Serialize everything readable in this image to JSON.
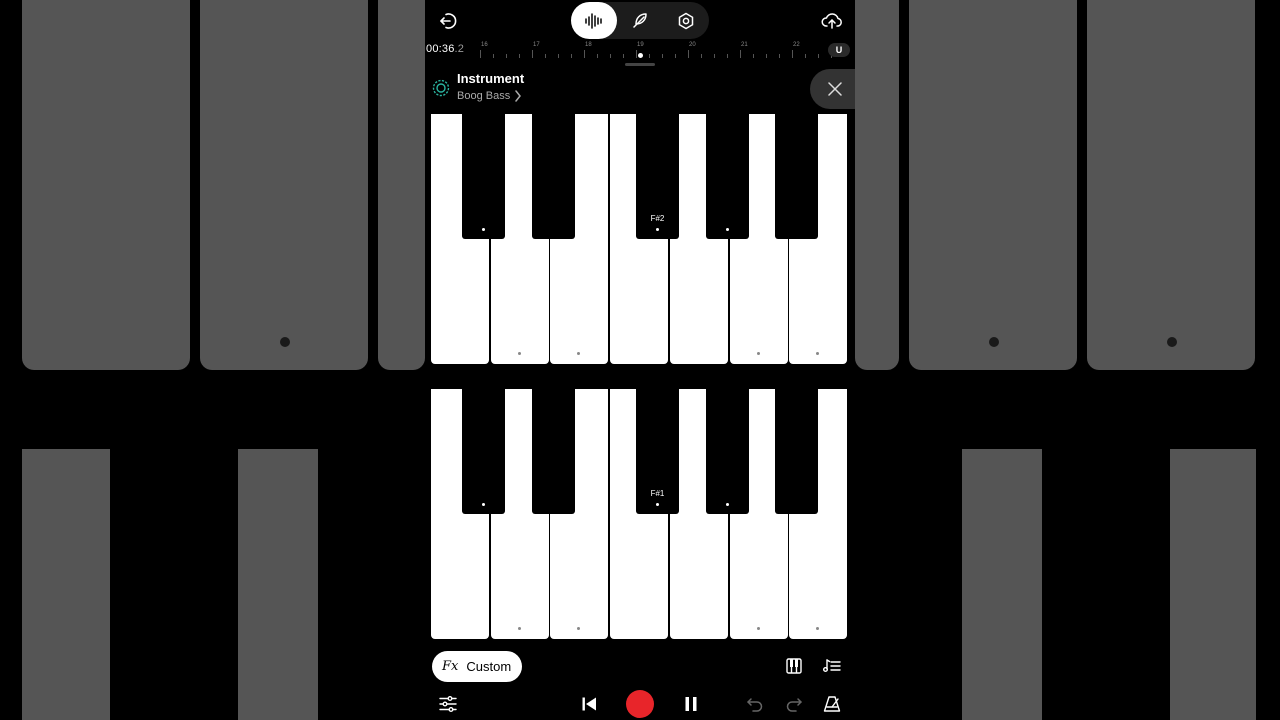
{
  "timeline": {
    "time_main": "00:36",
    "time_frac": ".2",
    "bar_labels": [
      "16",
      "17",
      "18",
      "19",
      "20",
      "21",
      "22"
    ],
    "snap_label": "U"
  },
  "instrument": {
    "title": "Instrument",
    "name": "Boog Bass"
  },
  "keyboard_top": {
    "labeled_note": "F#2"
  },
  "keyboard_bottom": {
    "labeled_note": "F#1"
  },
  "fx": {
    "fx_label": "Fx",
    "preset": "Custom"
  },
  "colors": {
    "record": "#e8252a",
    "accent": "#2ab4a0"
  },
  "icons": {
    "back": "exit-icon",
    "waveform": "waveform-icon",
    "pen": "quill-icon",
    "settings": "hex-settings-icon",
    "upload": "cloud-upload-icon",
    "instrument": "gear-ring-icon",
    "close": "close-icon",
    "keys": "piano-keys-icon",
    "arpeggio": "notes-list-icon",
    "mixer": "sliders-icon",
    "rewind": "skip-back-icon",
    "record": "record-icon",
    "pause": "pause-icon",
    "undo": "undo-icon",
    "redo": "redo-icon",
    "metronome": "metronome-icon"
  }
}
